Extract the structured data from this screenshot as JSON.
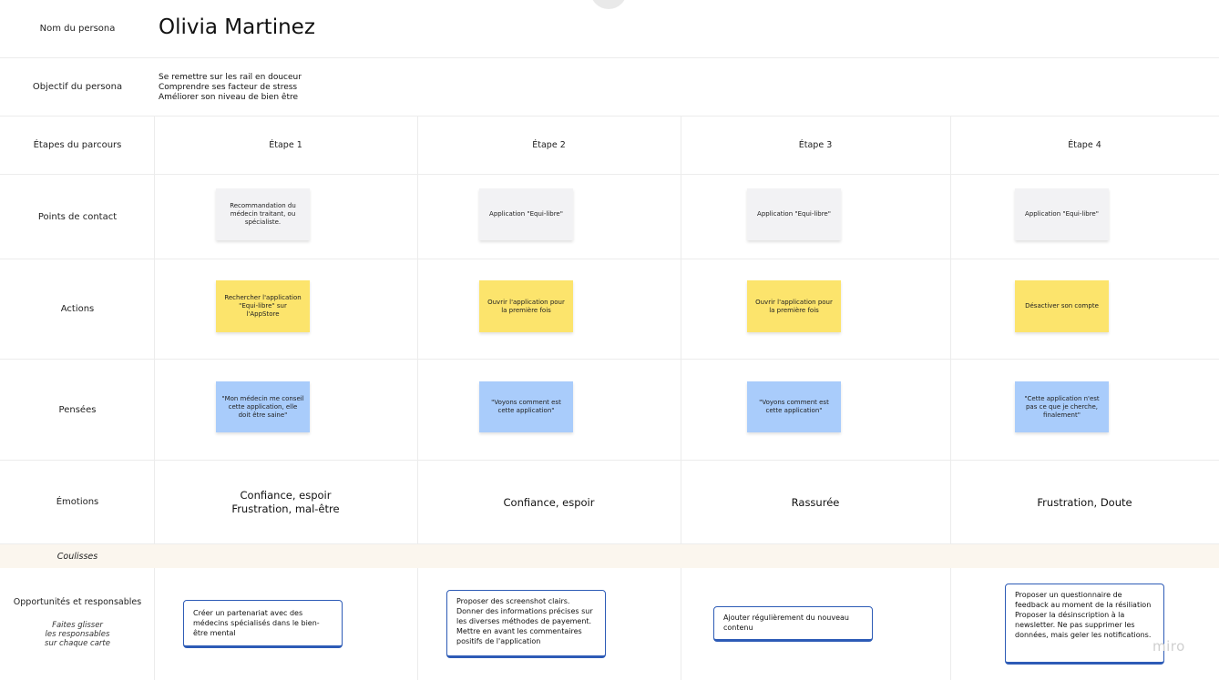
{
  "rows": {
    "persona_name": "Nom du persona",
    "persona_goal": "Objectif du persona",
    "stages": "Étapes du parcours",
    "touchpoints": "Points de contact",
    "actions": "Actions",
    "thoughts": "Pensées",
    "emotions": "Émotions",
    "backstage": "Coulisses",
    "opportunities": "Opportunités et responsables",
    "opportunities_hint_1": "Faites glisser",
    "opportunities_hint_2": "les responsables",
    "opportunities_hint_3": "sur chaque carte"
  },
  "persona": {
    "name": "Olivia Martinez",
    "goals": [
      "Se remettre sur les rail en douceur",
      "Comprendre ses facteur de stress",
      "Améliorer son niveau de bien être"
    ]
  },
  "stages": [
    {
      "title": "Étape 1",
      "touchpoint": "Recommandation du médecin traitant, ou spécialiste.",
      "action": "Rechercher l'application \"Equi-libre\" sur l'AppStore",
      "thought": "\"Mon médecin me conseil cette application, elle doit être saine\"",
      "emotion_1": "Confiance, espoir",
      "emotion_2": "Frustration, mal-être",
      "opportunity": "Créer un partenariat avec des médecins spécialisés dans le bien-être mental"
    },
    {
      "title": "Étape 2",
      "touchpoint": "Application \"Equi-libre\"",
      "action": "Ouvrir l'application pour la première fois",
      "thought": "\"Voyons comment est cette application\"",
      "emotion_1": "Confiance, espoir",
      "emotion_2": "",
      "opportunity": "Proposer des screenshot clairs. Donner des informations précises sur les diverses méthodes de payement. Mettre en avant les commentaires positifs de l'application"
    },
    {
      "title": "Étape 3",
      "touchpoint": "Application \"Equi-libre\"",
      "action": "Ouvrir l'application pour la première fois",
      "thought": "\"Voyons comment est cette application\"",
      "emotion_1": "Rassurée",
      "emotion_2": "",
      "opportunity": "Ajouter régulièrement du nouveau contenu"
    },
    {
      "title": "Étape 4",
      "touchpoint": "Application \"Equi-libre\"",
      "action": "Désactiver son compte",
      "thought": "\"Cette application n'est pas ce que je cherche, finalement\"",
      "emotion_1": "Frustration, Doute",
      "emotion_2": "",
      "opportunity": "Proposer un questionnaire de feedback au moment de la résiliation Proposer la désinscription à la newsletter. Ne pas supprimer les données, mais geler les notifications."
    }
  ],
  "brand": {
    "watermark": "miro"
  },
  "colors": {
    "sticky_gray": "#f2f2f4",
    "sticky_yellow": "#fce46c",
    "sticky_blue": "#a9ccfb",
    "card_border": "#2d5bb6",
    "backstage_band": "#fbf6ee"
  }
}
